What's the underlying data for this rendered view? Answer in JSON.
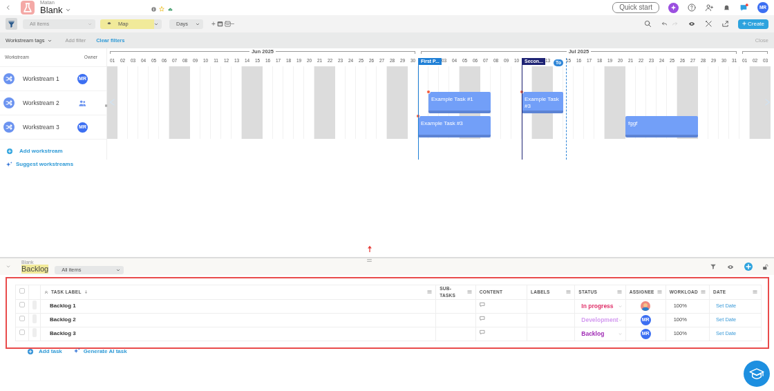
{
  "header": {
    "workspace": "Matan",
    "title": "Blank",
    "quick_start": "Quick start",
    "chat_unread": true,
    "user_initials": "MR"
  },
  "toolbar": {
    "view_filter": {
      "value": "All items",
      "disabled": true
    },
    "group_by": {
      "value": "Map",
      "highlighted": true
    },
    "scale": {
      "value": "Days"
    },
    "zoom_in": "+",
    "zoom_out": "−",
    "redo_disabled": true,
    "create": "Create"
  },
  "filter_bar": {
    "tags": "Workstream tags",
    "add_filter": {
      "label": "Add filter",
      "disabled": true
    },
    "clear": "Clear filters",
    "close": "Close"
  },
  "gantt": {
    "columns": [
      "Workstream",
      "Owner"
    ],
    "months": [
      {
        "label": "Jun 2025",
        "days": [
          {
            "label": "01",
            "weekend": true
          },
          {
            "label": "02",
            "weekend": false
          },
          {
            "label": "03",
            "weekend": false
          },
          {
            "label": "04",
            "weekend": false
          },
          {
            "label": "05",
            "weekend": false
          },
          {
            "label": "06",
            "weekend": false
          },
          {
            "label": "07",
            "weekend": true
          },
          {
            "label": "08",
            "weekend": true
          },
          {
            "label": "09",
            "weekend": false
          },
          {
            "label": "10",
            "weekend": false
          },
          {
            "label": "11",
            "weekend": false
          },
          {
            "label": "12",
            "weekend": false
          },
          {
            "label": "13",
            "weekend": false
          },
          {
            "label": "14",
            "weekend": true
          },
          {
            "label": "15",
            "weekend": true
          },
          {
            "label": "16",
            "weekend": false
          },
          {
            "label": "17",
            "weekend": false
          },
          {
            "label": "18",
            "weekend": false
          },
          {
            "label": "19",
            "weekend": false
          },
          {
            "label": "20",
            "weekend": false
          },
          {
            "label": "21",
            "weekend": true
          },
          {
            "label": "22",
            "weekend": true
          },
          {
            "label": "23",
            "weekend": false
          },
          {
            "label": "24",
            "weekend": false
          },
          {
            "label": "25",
            "weekend": false
          },
          {
            "label": "26",
            "weekend": false
          },
          {
            "label": "27",
            "weekend": false
          },
          {
            "label": "28",
            "weekend": true
          },
          {
            "label": "29",
            "weekend": true
          },
          {
            "label": "30",
            "weekend": false
          }
        ]
      },
      {
        "label": "Jul 2025",
        "days": [
          {
            "weekend": false
          },
          {
            "weekend": false
          },
          {
            "label": "03",
            "weekend": false
          },
          {
            "label": "04",
            "weekend": false
          },
          {
            "label": "05",
            "weekend": true
          },
          {
            "label": "06",
            "weekend": true
          },
          {
            "label": "07",
            "weekend": false
          },
          {
            "label": "08",
            "weekend": false
          },
          {
            "label": "09",
            "weekend": false
          },
          {
            "label": "10",
            "weekend": false
          },
          {
            "weekend": false
          },
          {
            "weekend": true
          },
          {
            "label": "13",
            "weekend": true
          },
          {
            "weekend": false
          },
          {
            "label": "15",
            "weekend": false
          },
          {
            "label": "16",
            "weekend": false
          },
          {
            "label": "17",
            "weekend": false
          },
          {
            "label": "18",
            "weekend": false
          },
          {
            "label": "19",
            "weekend": true
          },
          {
            "label": "20",
            "weekend": true
          },
          {
            "label": "21",
            "weekend": false
          },
          {
            "label": "22",
            "weekend": false
          },
          {
            "label": "23",
            "weekend": false
          },
          {
            "label": "24",
            "weekend": false
          },
          {
            "label": "25",
            "weekend": false
          },
          {
            "label": "26",
            "weekend": true
          },
          {
            "label": "27",
            "weekend": true
          },
          {
            "label": "28",
            "weekend": false
          },
          {
            "label": "29",
            "weekend": false
          },
          {
            "label": "30",
            "weekend": false
          },
          {
            "label": "31",
            "weekend": false
          }
        ]
      },
      {
        "days": [
          {
            "label": "01",
            "weekend": false
          },
          {
            "label": "02",
            "weekend": true
          },
          {
            "label": "03",
            "weekend": true
          }
        ]
      }
    ],
    "markers": [
      {
        "kind": "milestone",
        "label": "First P...",
        "color": "#1f7fd6"
      },
      {
        "kind": "milestone",
        "label": "Secon...",
        "color": "#1e2374"
      },
      {
        "kind": "today",
        "label": "To",
        "color": "#2f86d8"
      }
    ],
    "workstreams": [
      {
        "name": "Workstream 1",
        "owner": {
          "kind": "initials",
          "text": "MR"
        }
      },
      {
        "name": "Workstream 2",
        "owner": {
          "kind": "group"
        },
        "tasks": [
          {
            "title": "Example Task #1",
            "flagged": true
          },
          {
            "title": "Example Task #3",
            "flagged": true
          }
        ]
      },
      {
        "name": "Workstream 3",
        "owner": {
          "kind": "initials",
          "text": "MR"
        },
        "tasks": [
          {
            "title": "Example Task #3",
            "flagged": true
          },
          {
            "title": "fggf",
            "flagged": false
          }
        ]
      }
    ],
    "add": "Add workstream",
    "suggest": "Suggest workstreams"
  },
  "annotation": {
    "kind": "arrow"
  },
  "backlog": {
    "parent": "Blank",
    "title": "Backlog",
    "highlighted": true,
    "view": "All items",
    "outlined": true,
    "all_checked": false,
    "columns": [
      {
        "label": "TASK LABEL",
        "sorted": true,
        "menu": true
      },
      {
        "label": "SUB-TASKS",
        "sorted": false,
        "menu": true
      },
      {
        "label": "CONTENT",
        "sorted": false,
        "menu": false
      },
      {
        "label": "LABELS",
        "sorted": false,
        "menu": true
      },
      {
        "label": "STATUS",
        "sorted": false,
        "menu": true
      },
      {
        "label": "ASSIGNEE",
        "sorted": false,
        "menu": true
      },
      {
        "label": "WORKLOAD",
        "sorted": false,
        "menu": true
      },
      {
        "label": "DATE",
        "sorted": false,
        "menu": true
      }
    ],
    "rows": [
      {
        "label": "Backlog 1",
        "checked": false,
        "status": {
          "text": "In progress",
          "color": "#e0336b"
        },
        "assignee": {
          "kind": "photo"
        },
        "workload": "100%",
        "date": "Set Date"
      },
      {
        "label": "Backlog 2",
        "checked": false,
        "status": {
          "text": "Development",
          "color": "#d49cf0"
        },
        "assignee": {
          "kind": "initials",
          "text": "MR"
        },
        "workload": "100%",
        "date": "Set Date"
      },
      {
        "label": "Backlog 3",
        "checked": false,
        "status": {
          "text": "Backlog",
          "color": "#a02bb5"
        },
        "assignee": {
          "kind": "initials",
          "text": "MR"
        },
        "workload": "100%",
        "date": "Set Date"
      }
    ],
    "add_task": "Add task",
    "generate": "Generate AI task"
  }
}
